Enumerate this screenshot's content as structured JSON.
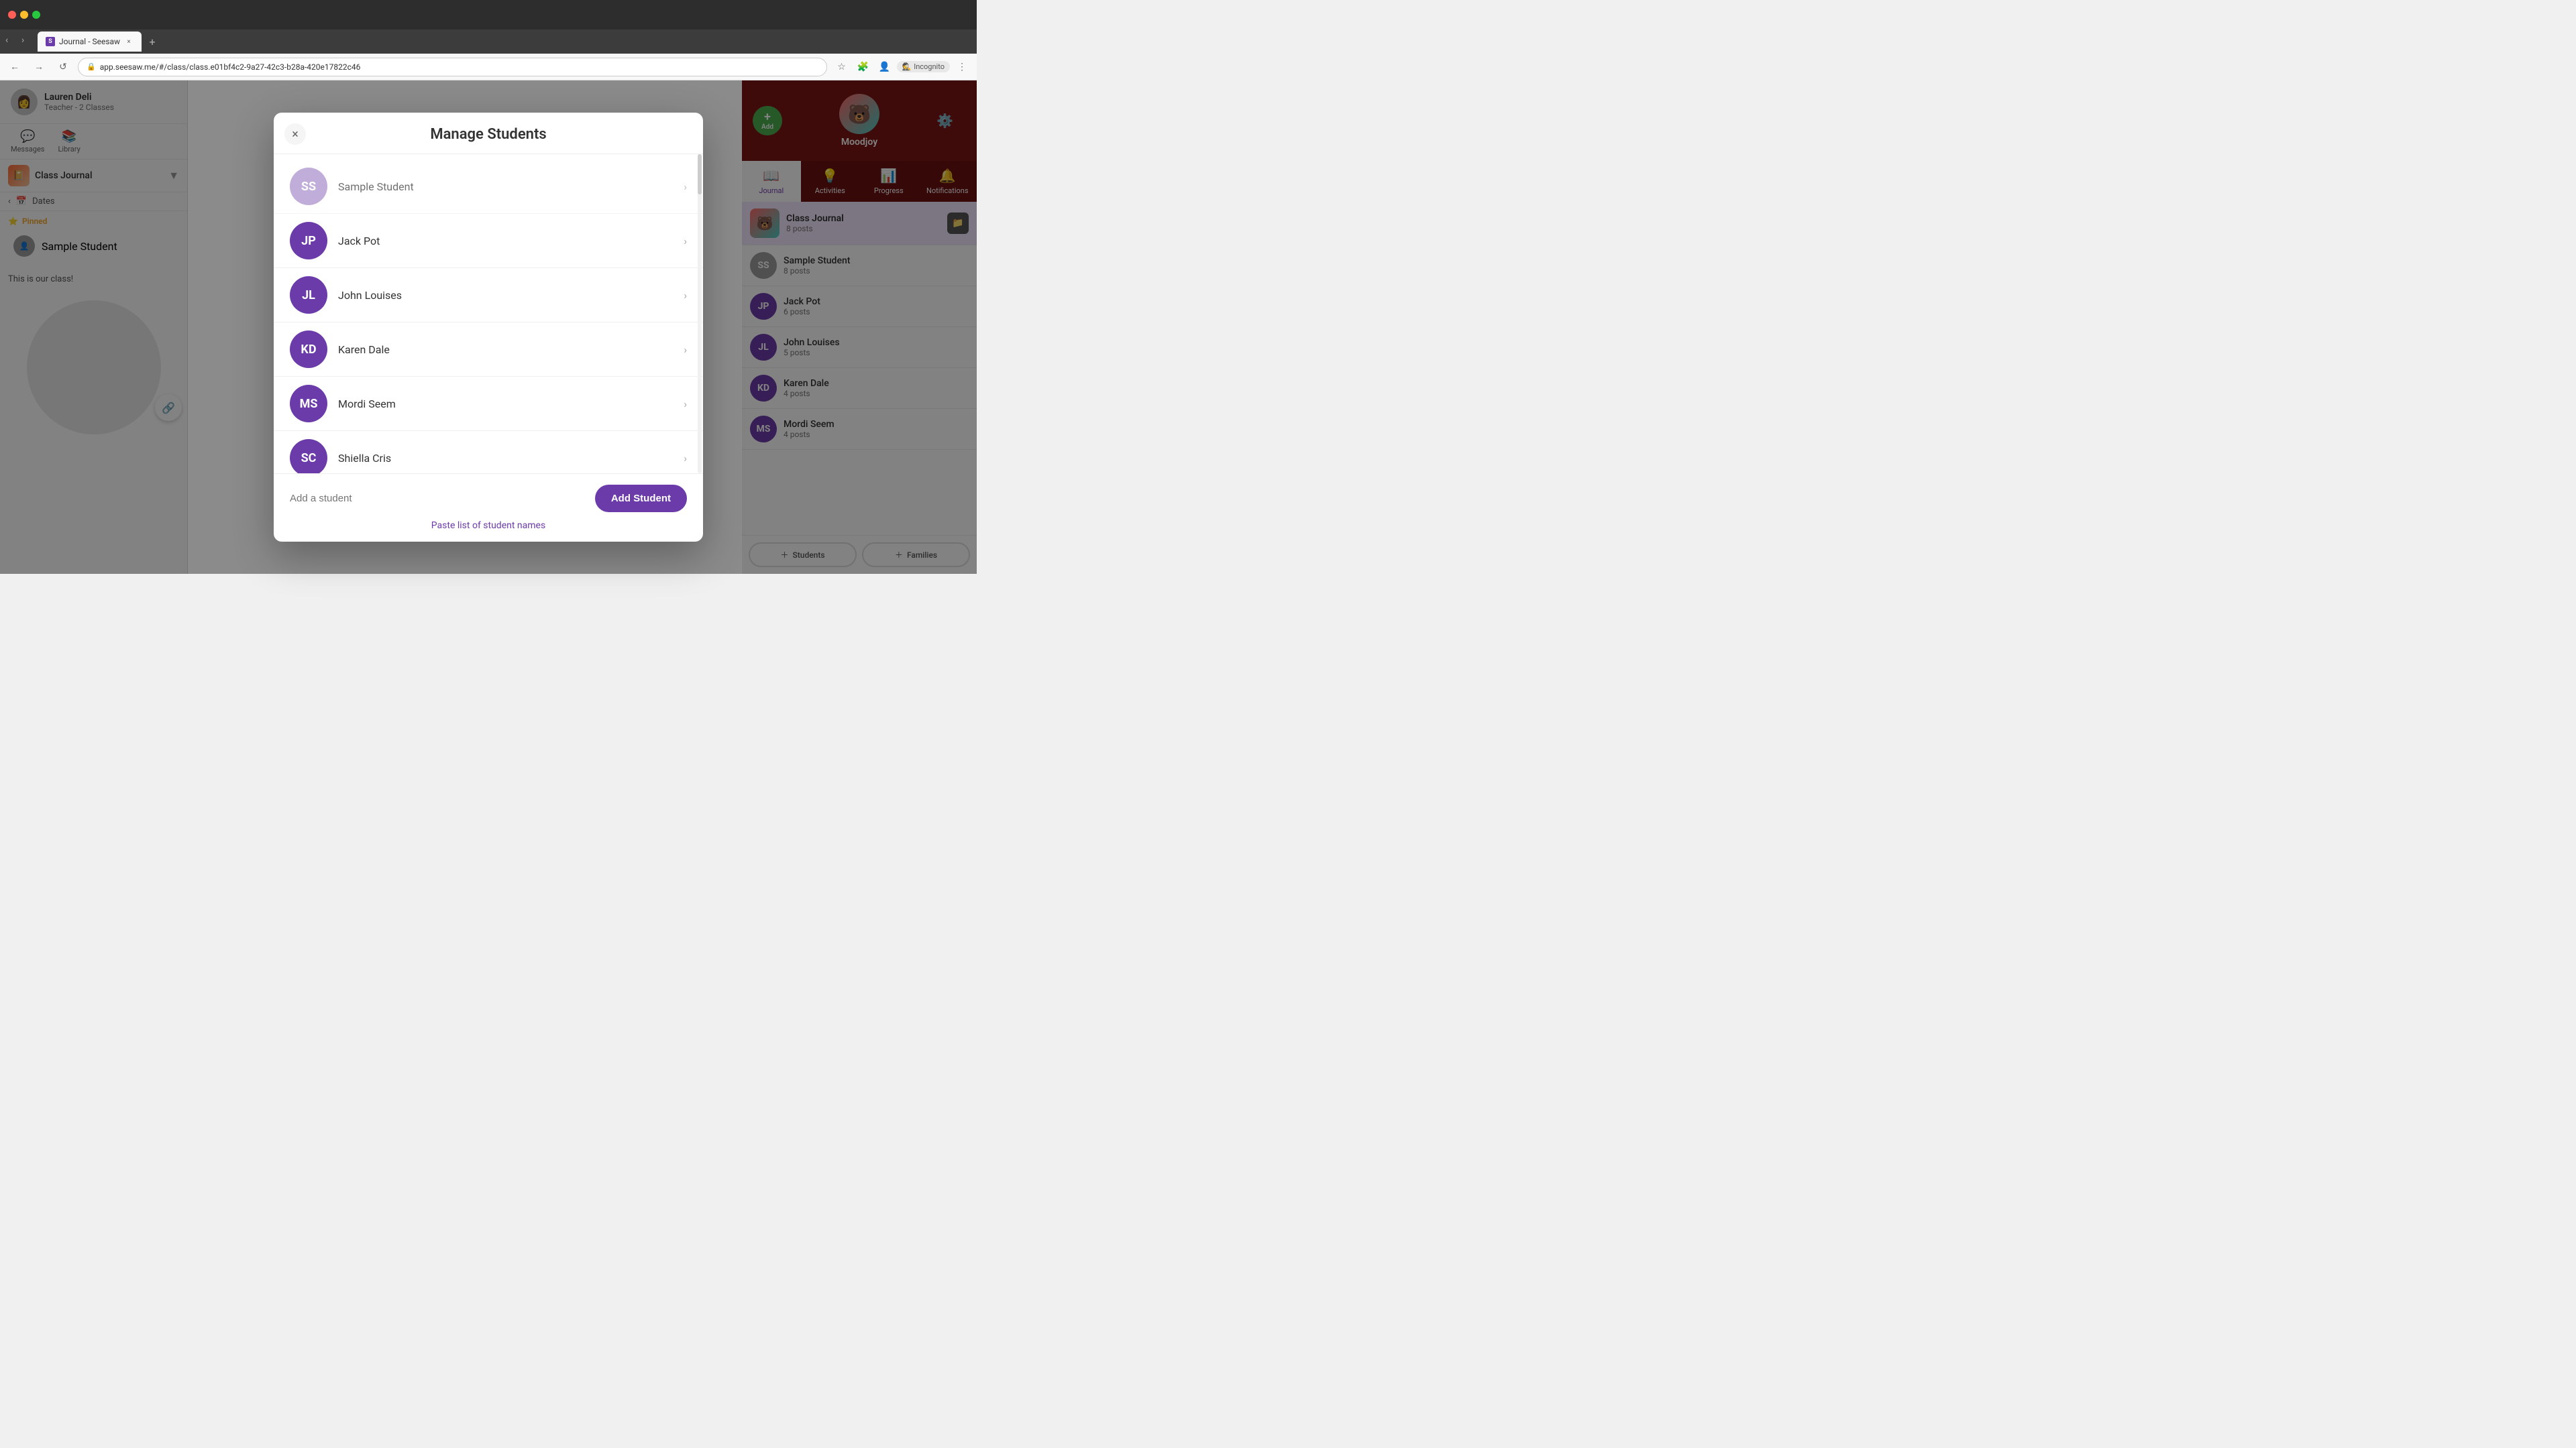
{
  "browser": {
    "tab_title": "Journal - Seesaw",
    "tab_favicon": "S",
    "address": "app.seesaw.me/#/class/class.e01bf4c2-9a27-42c3-b28a-420e17822c46",
    "incognito_label": "Incognito"
  },
  "sidebar": {
    "teacher_name": "Lauren Deli",
    "teacher_role": "Teacher - 2 Classes",
    "nav_messages": "Messages",
    "nav_library": "Library",
    "class_name": "Class Journal",
    "date_label": "Dates",
    "pinned_label": "Pinned",
    "sample_student": "Sample Student",
    "this_is_class": "This is our class!"
  },
  "right_panel": {
    "moodjoy_name": "Moodjoy",
    "add_label": "Add",
    "journal_label": "Journal",
    "activities_label": "Activities",
    "progress_label": "Progress",
    "notifications_label": "Notifications",
    "class_journal_name": "Class Journal",
    "class_journal_posts": "8 posts",
    "students": [
      {
        "name": "Sample Student",
        "posts": "8 posts",
        "initials": "SS",
        "color": "#9e9e9e"
      },
      {
        "name": "Jack Pot",
        "posts": "6 posts",
        "initials": "JP",
        "color": "#6c3baa"
      },
      {
        "name": "John Louises",
        "posts": "5 posts",
        "initials": "JL",
        "color": "#6c3baa"
      },
      {
        "name": "Karen Dale",
        "posts": "4 posts",
        "initials": "KD",
        "color": "#6c3baa"
      },
      {
        "name": "Mordi Seem",
        "posts": "4 posts",
        "initials": "MS",
        "color": "#6c3baa"
      }
    ],
    "btn_students": "Students",
    "btn_families": "Families"
  },
  "modal": {
    "title": "Manage Students",
    "close_label": "×",
    "students": [
      {
        "name": "Sample Student",
        "initials": "SS",
        "color": "#a78bca"
      },
      {
        "name": "Jack Pot",
        "initials": "JP",
        "color": "#6c3baa"
      },
      {
        "name": "John Louises",
        "initials": "JL",
        "color": "#6c3baa"
      },
      {
        "name": "Karen Dale",
        "initials": "KD",
        "color": "#6c3baa"
      },
      {
        "name": "Mordi Seem",
        "initials": "MS",
        "color": "#6c3baa"
      },
      {
        "name": "Shiella Cris",
        "initials": "SC",
        "color": "#6c3baa"
      }
    ],
    "input_placeholder": "Add a student",
    "add_student_btn": "Add Student",
    "paste_link": "Paste list of student names"
  }
}
